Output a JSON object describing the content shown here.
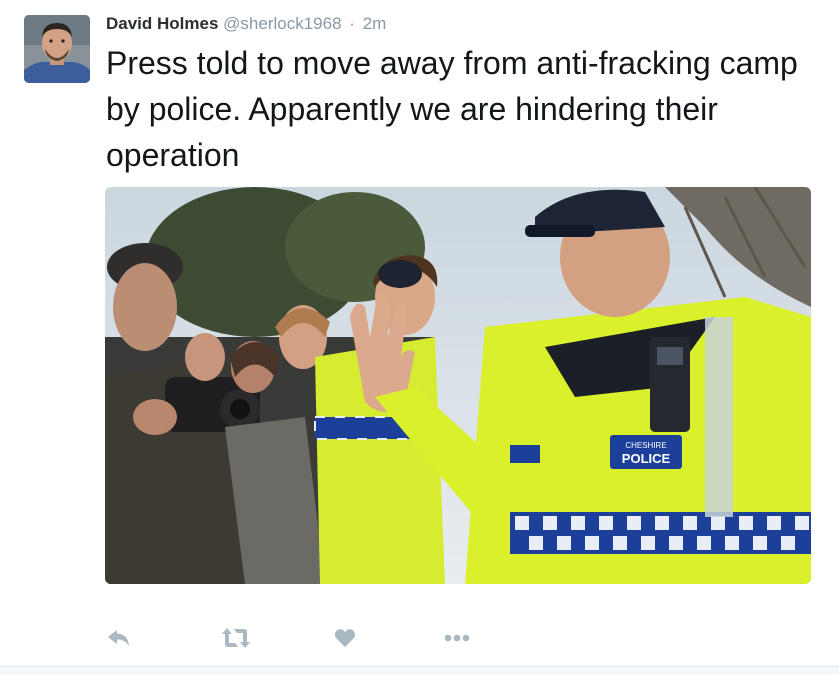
{
  "tweet": {
    "author_name": "David Holmes",
    "author_handle": "@sherlock1968",
    "separator": "·",
    "timestamp": "2m",
    "text": "Press told to move away from anti-fracking camp by police. Apparently we are hindering their operation",
    "media": {
      "patch_text": "CHESHIRE POLICE"
    },
    "actions": [
      "reply-icon",
      "retweet-icon",
      "like-icon",
      "more-icon"
    ]
  },
  "colors": {
    "name": "#292f33",
    "meta": "#8899a6",
    "text": "#14171a",
    "action_icon": "#aab8c2",
    "hi_vis": "#d9f02a",
    "police_blue": "#1c3f9a"
  }
}
